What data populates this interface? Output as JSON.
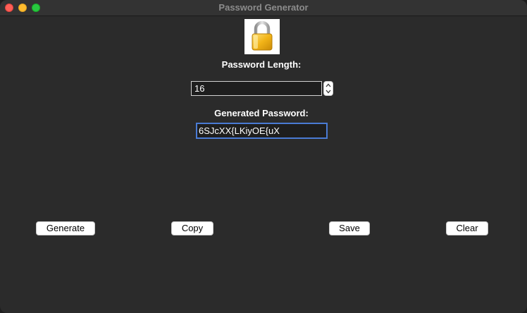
{
  "window": {
    "title": "Password Generator"
  },
  "icon": {
    "name": "lock-icon",
    "colors": {
      "body": "#f2b418",
      "shackle": "#c9c9c9"
    }
  },
  "length": {
    "label": "Password Length:",
    "value": "16"
  },
  "generated": {
    "label": "Generated Password:",
    "value": "6SJcXX{LKiyOE{uX"
  },
  "buttons": {
    "generate": "Generate",
    "copy": "Copy",
    "save": "Save",
    "clear": "Clear"
  },
  "colors": {
    "background": "#2b2b2b",
    "focus_border": "#4a7bd4"
  }
}
